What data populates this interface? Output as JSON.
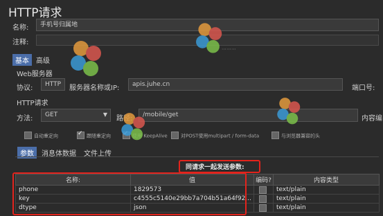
{
  "title": "HTTP请求",
  "name_label": "名称:",
  "name_value": "手机号归属地",
  "comment_label": "注释:",
  "tabs_top": [
    "基本",
    "高级"
  ],
  "web_server_label": "Web服务器",
  "protocol_label": "协议:",
  "protocol_value": "HTTP",
  "server_label": "服务器名称或IP:",
  "server_value": "apis.juhe.cn",
  "port_label": "端口号:",
  "http_request_label": "HTTP请求",
  "method_label": "方法:",
  "method_value": "GET",
  "path_label": "路径:",
  "path_value": "/mobile/get",
  "content_encoding_label": "内容编",
  "checkboxes": [
    {
      "label": "自动重定向",
      "checked": false
    },
    {
      "label": "跟随重定向",
      "checked": true
    },
    {
      "label": "使用 KeepAlive",
      "checked": true
    },
    {
      "label": "对POST使用multipart / form-data",
      "checked": false
    },
    {
      "label": "与浏览器兼容的头",
      "checked": false
    }
  ],
  "tabs_bottom": [
    "参数",
    "消息体数据",
    "文件上传"
  ],
  "send_params_label": "同请求一起发送参数:",
  "table": {
    "headers": [
      "名称:",
      "值",
      "编码?",
      "内容类型"
    ],
    "rows": [
      {
        "name": "phone",
        "value": "1829573",
        "encode": false,
        "type": "text/plain"
      },
      {
        "name": "key",
        "value": "c4555c5140e29bb7a704b51a64f92...",
        "encode": false,
        "type": "text/plain"
      },
      {
        "name": "dtype",
        "value": "json",
        "encode": false,
        "type": "text/plain"
      }
    ]
  },
  "colors": {
    "highlight": "#e3231c",
    "tab_active": "#4b6ea9",
    "background": "#2b2b2b"
  },
  "watermark_icons": [
    "pinwheel-watermark-icon"
  ]
}
